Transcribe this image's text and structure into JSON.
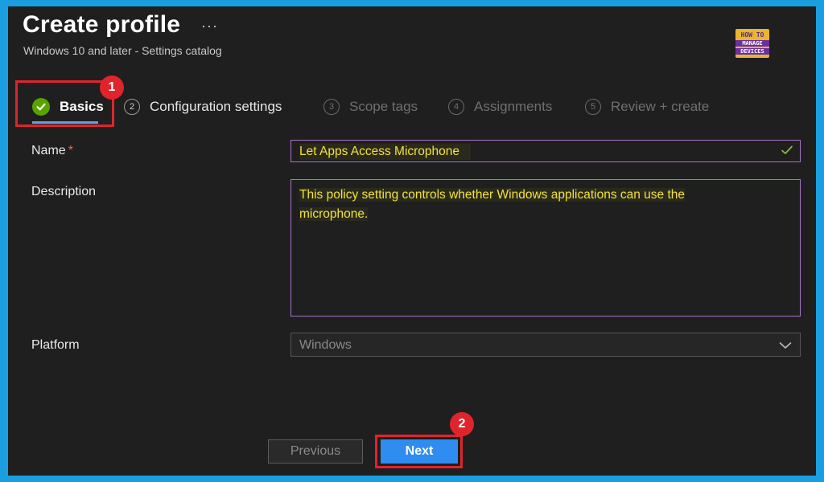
{
  "header": {
    "title": "Create profile",
    "more": "···",
    "subtitle": "Windows 10 and later - Settings catalog",
    "logo": {
      "line1": "HOW TO",
      "line2": "MANAGE",
      "line3": "DEVICES"
    }
  },
  "tabs": [
    {
      "num": "",
      "label": "Basics",
      "state": "active"
    },
    {
      "num": "2",
      "label": "Configuration settings",
      "state": "normal"
    },
    {
      "num": "3",
      "label": "Scope tags",
      "state": "disabled"
    },
    {
      "num": "4",
      "label": "Assignments",
      "state": "disabled"
    },
    {
      "num": "5",
      "label": "Review + create",
      "state": "disabled"
    }
  ],
  "form": {
    "name_label": "Name",
    "required_mark": "*",
    "name_value": "Let Apps Access Microphone",
    "description_label": "Description",
    "description_value": "This policy setting controls whether Windows applications can use the microphone.",
    "platform_label": "Platform",
    "platform_value": "Windows"
  },
  "footer": {
    "previous_label": "Previous",
    "next_label": "Next"
  },
  "annotations": {
    "badge1": "1",
    "badge2": "2"
  },
  "colors": {
    "accent": "#2f8cf0",
    "highlight_text": "#f3e23a",
    "annotation_red": "#e0242d",
    "success_green": "#57a300"
  }
}
